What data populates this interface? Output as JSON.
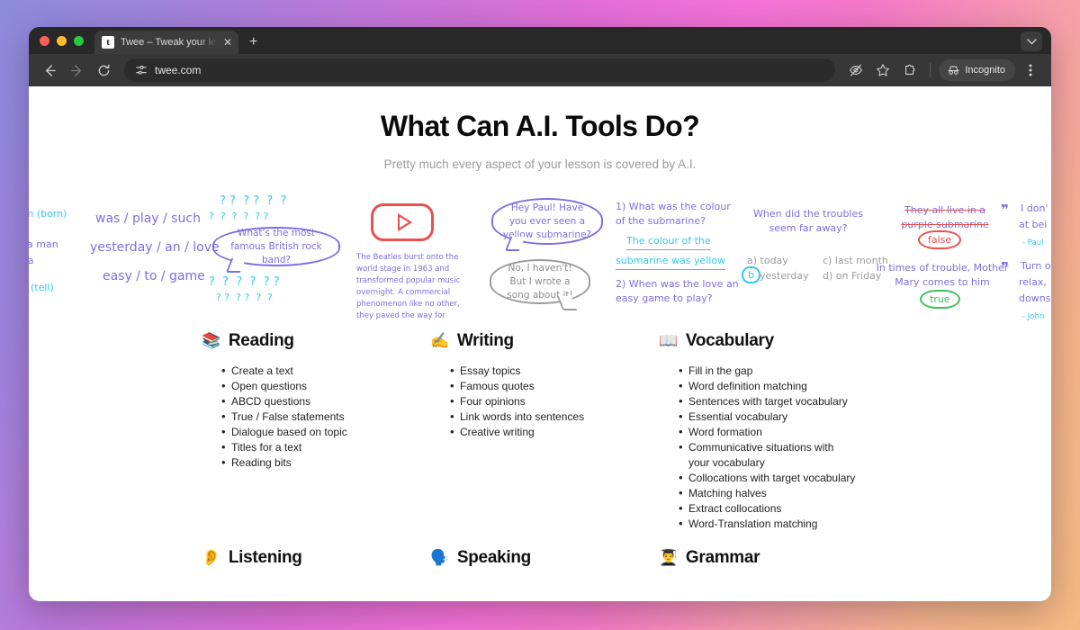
{
  "browser": {
    "tab": {
      "title": "Twee – Tweak your lessons w",
      "favicon_letter": "t",
      "close_icon": "close-icon"
    },
    "new_tab_label": "+",
    "tab_list_icon": "chevron-down-icon",
    "back_icon": "back-arrow-icon",
    "forward_icon": "forward-arrow-icon",
    "reload_icon": "reload-icon",
    "url": "twee.com",
    "site_settings_icon": "tune-icon",
    "tracking_icon": "eye-off-icon",
    "bookmark_icon": "star-icon",
    "extensions_icon": "puzzle-icon",
    "incognito_label": "Incognito",
    "incognito_icon": "incognito-hat-icon",
    "menu_icon": "kebab-menu-icon"
  },
  "page": {
    "headline": "What Can A.I. Tools Do?",
    "subhead": "Pretty much every aspect of your lesson is covered by A.I."
  },
  "illustration": {
    "col1": {
      "line1": "rn (born)",
      "line2": "a man",
      "line3": "ea",
      "line4": "(tell)"
    },
    "col2": {
      "line1": "was / play / such",
      "line2": "yesterday / an / love",
      "line3": "easy / to / game"
    },
    "col3": {
      "bubble": "What's the most famous British rock band?"
    },
    "col4": {
      "paragraph": "The Beatles burst onto the world stage in 1963 and transformed popular music overnight. A commercial phenomenon like no other, they paved the way for"
    },
    "col5": {
      "bubble_purple": "Hey Paul! Have you ever seen a yellow submarine?",
      "bubble_gray": "No, I haven't! But I wrote a song about it!"
    },
    "col6": {
      "q1": "1) What was the colour of the submarine?",
      "answer_line1": "The colour of the",
      "answer_line2": "submarine was yellow",
      "q2": "2) When was the love an easy game to play?"
    },
    "col7": {
      "question": "When did the troubles seem far away?",
      "option_a": "a) today",
      "option_b": "yesterday",
      "option_b_marker": "b",
      "option_c": "c) last month",
      "option_d": "d) on Friday"
    },
    "col8": {
      "statement1": "They all live in a purple submarine",
      "verdict1": "false",
      "statement2": "In times of trouble, Mother Mary comes to him",
      "verdict2": "true"
    },
    "col9": {
      "quote1_line1": "I don'",
      "quote1_line2": "at bei",
      "quote1_author": "- Paul",
      "quote2_line1": "Turn o",
      "quote2_line2": "relax,",
      "quote2_line3": "downs",
      "quote2_author": "- John"
    }
  },
  "categories": [
    {
      "name": "Reading",
      "emoji": "📚",
      "icon": "books-icon",
      "items": [
        "Create a text",
        "Open questions",
        "ABCD questions",
        "True / False statements",
        "Dialogue based on topic",
        "Titles for a text",
        "Reading bits"
      ]
    },
    {
      "name": "Writing",
      "emoji": "✍️",
      "icon": "writing-hand-icon",
      "items": [
        "Essay topics",
        "Famous quotes",
        "Four opinions",
        "Link words into sentences",
        "Creative writing"
      ]
    },
    {
      "name": "Vocabulary",
      "emoji": "📖",
      "icon": "open-book-icon",
      "items": [
        "Fill in the gap",
        "Word definition matching",
        "Sentences with target vocabulary",
        "Essential vocabulary",
        "Word formation",
        "Communicative situations with your vocabulary",
        "Collocations with target vocabulary",
        "Matching halves",
        "Extract collocations",
        "Word-Translation matching"
      ]
    }
  ],
  "categories_row2": [
    {
      "name": "Listening",
      "emoji": "👂",
      "icon": "ear-icon"
    },
    {
      "name": "Speaking",
      "emoji": "🗣️",
      "icon": "speaking-head-icon"
    },
    {
      "name": "Grammar",
      "emoji": "👨‍🎓",
      "icon": "student-icon"
    }
  ],
  "colors": {
    "accent_purple": "#7b6fe0",
    "accent_cyan": "#35c8ee",
    "accent_red": "#e8514e",
    "accent_green": "#3fbf5e"
  }
}
